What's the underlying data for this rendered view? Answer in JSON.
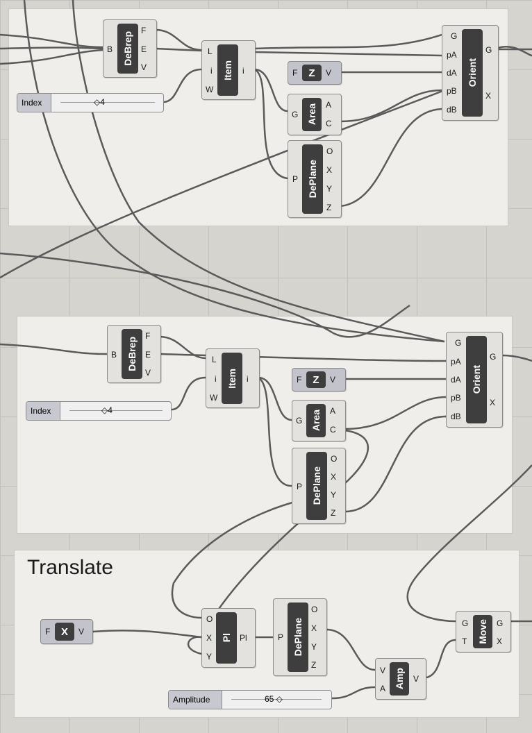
{
  "groups": {
    "translate_title": "Translate"
  },
  "g1": {
    "debrep": {
      "name": "DeBrep",
      "in": [
        "B"
      ],
      "out": [
        "F",
        "E",
        "V"
      ]
    },
    "item": {
      "name": "Item",
      "in": [
        "L",
        "i",
        "W"
      ],
      "out": [
        "i"
      ]
    },
    "index_slider": {
      "label": "Index",
      "value": "◇4"
    },
    "z": {
      "name": "Z",
      "in": [
        "F"
      ],
      "out": [
        "V"
      ]
    },
    "area": {
      "name": "Area",
      "in": [
        "G"
      ],
      "out": [
        "A",
        "C"
      ]
    },
    "deplane": {
      "name": "DePlane",
      "in": [
        "P"
      ],
      "out": [
        "O",
        "X",
        "Y",
        "Z"
      ]
    },
    "orient": {
      "name": "Orient",
      "in": [
        "G",
        "pA",
        "dA",
        "pB",
        "dB"
      ],
      "out": [
        "G",
        "X"
      ]
    }
  },
  "g2": {
    "debrep": {
      "name": "DeBrep",
      "in": [
        "B"
      ],
      "out": [
        "F",
        "E",
        "V"
      ]
    },
    "item": {
      "name": "Item",
      "in": [
        "L",
        "i",
        "W"
      ],
      "out": [
        "i"
      ]
    },
    "index_slider": {
      "label": "Index",
      "value": "◇4"
    },
    "z": {
      "name": "Z",
      "in": [
        "F"
      ],
      "out": [
        "V"
      ]
    },
    "area": {
      "name": "Area",
      "in": [
        "G"
      ],
      "out": [
        "A",
        "C"
      ]
    },
    "deplane": {
      "name": "DePlane",
      "in": [
        "P"
      ],
      "out": [
        "O",
        "X",
        "Y",
        "Z"
      ]
    },
    "orient": {
      "name": "Orient",
      "in": [
        "G",
        "pA",
        "dA",
        "pB",
        "dB"
      ],
      "out": [
        "G",
        "X"
      ]
    }
  },
  "g3": {
    "x": {
      "name": "X",
      "in": [
        "F"
      ],
      "out": [
        "V"
      ]
    },
    "pl": {
      "name": "Pl",
      "in": [
        "O",
        "X",
        "Y"
      ],
      "out": [
        "Pl"
      ]
    },
    "deplane": {
      "name": "DePlane",
      "in": [
        "P"
      ],
      "out": [
        "O",
        "X",
        "Y",
        "Z"
      ]
    },
    "amp": {
      "name": "Amp",
      "in": [
        "V",
        "A"
      ],
      "out": [
        "V"
      ]
    },
    "move": {
      "name": "Move",
      "in": [
        "G",
        "T"
      ],
      "out": [
        "G",
        "X"
      ]
    },
    "amplitude_slider": {
      "label": "Amplitude",
      "value": "65 ◇"
    }
  }
}
